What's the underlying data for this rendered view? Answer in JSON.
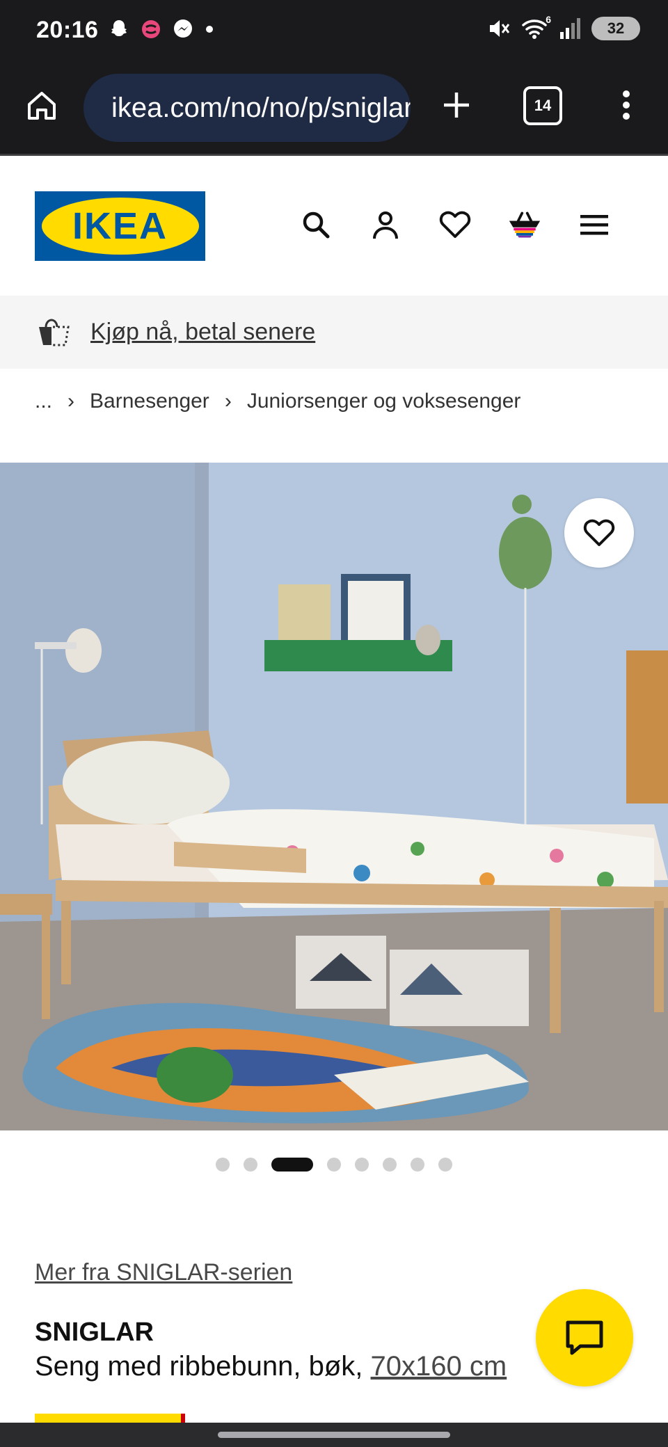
{
  "status_bar": {
    "time": "20:16",
    "left_icons": [
      "snapchat-icon",
      "threads-icon",
      "messenger-icon",
      "dot-icon"
    ],
    "right_icons": [
      "mute-icon",
      "wifi-icon",
      "signal-icon"
    ],
    "wifi_label": "6",
    "battery": "32"
  },
  "browser": {
    "url": "ikea.com/no/no/p/sniglar",
    "tab_count": "14"
  },
  "header": {
    "logo_text": "IKEA",
    "icons": [
      "search-icon",
      "account-icon",
      "heart-icon",
      "basket-icon",
      "menu-icon"
    ]
  },
  "promo": {
    "text": "Kjøp nå, betal senere"
  },
  "breadcrumb": {
    "ellipsis": "...",
    "items": [
      "Barnesenger",
      "Juniorsenger og voksesenger"
    ]
  },
  "carousel": {
    "count": 8,
    "active_index": 2
  },
  "product": {
    "series_link": "Mer fra SNIGLAR-serien",
    "name": "SNIGLAR",
    "description": "Seng med ribbebunn, bøk, ",
    "size_link": "70x160 cm"
  },
  "colors": {
    "ikea_blue": "#0058a3",
    "ikea_yellow": "#ffdb00"
  }
}
